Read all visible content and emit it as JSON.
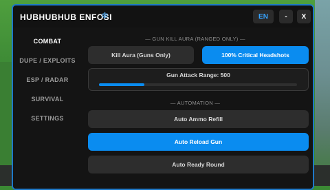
{
  "window": {
    "title": "HUBHUBHUB ENFOSI",
    "title_icon": "snowflake-icon"
  },
  "titlebar": {
    "lang_label": "EN",
    "minimize_label": "-",
    "close_label": "X"
  },
  "sidebar": {
    "items": [
      {
        "label": "COMBAT",
        "active": true
      },
      {
        "label": "DUPE / EXPLOITS",
        "active": false
      },
      {
        "label": "ESP / RADAR",
        "active": false
      },
      {
        "label": "SURVIVAL",
        "active": false
      },
      {
        "label": "SETTINGS",
        "active": false
      }
    ]
  },
  "main": {
    "section_gun": "— GUN KILL AURA (RANGED ONLY) —",
    "kill_aura_label": "Kill Aura (Guns Only)",
    "kill_aura_on": false,
    "crit_label": "100% Critical Headshots",
    "crit_on": true,
    "range_label": "Gun Attack Range: 500",
    "range_fraction": 0.23,
    "section_auto": "— AUTOMATION —",
    "auto_ammo_label": "Auto Ammo Refill",
    "auto_ammo_on": false,
    "auto_reload_label": "Auto Reload Gun",
    "auto_reload_on": true,
    "auto_ready_label": "Auto Ready Round",
    "auto_ready_on": false
  },
  "colors": {
    "accent": "#0a8cf0",
    "border": "#1e78c8",
    "lang_text": "#36a3ff"
  }
}
